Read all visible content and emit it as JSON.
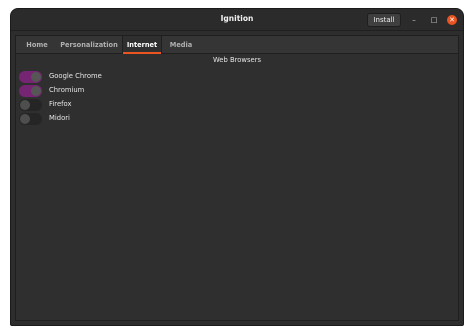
{
  "window": {
    "title": "Ignition",
    "install_label": "Install",
    "min_glyph": "–",
    "max_glyph": "□",
    "close_glyph": "✕"
  },
  "tabs": [
    {
      "label": "Home",
      "active": false
    },
    {
      "label": "Personalization",
      "active": false
    },
    {
      "label": "Internet",
      "active": true
    },
    {
      "label": "Media",
      "active": false
    }
  ],
  "section": {
    "title": "Web Browsers",
    "items": [
      {
        "label": "Google Chrome",
        "enabled": true
      },
      {
        "label": "Chromium",
        "enabled": true
      },
      {
        "label": "Firefox",
        "enabled": false
      },
      {
        "label": "Midori",
        "enabled": false
      }
    ]
  },
  "colors": {
    "accent": "#e95420",
    "toggle_on": "#762572",
    "background": "#2d2d2d"
  }
}
